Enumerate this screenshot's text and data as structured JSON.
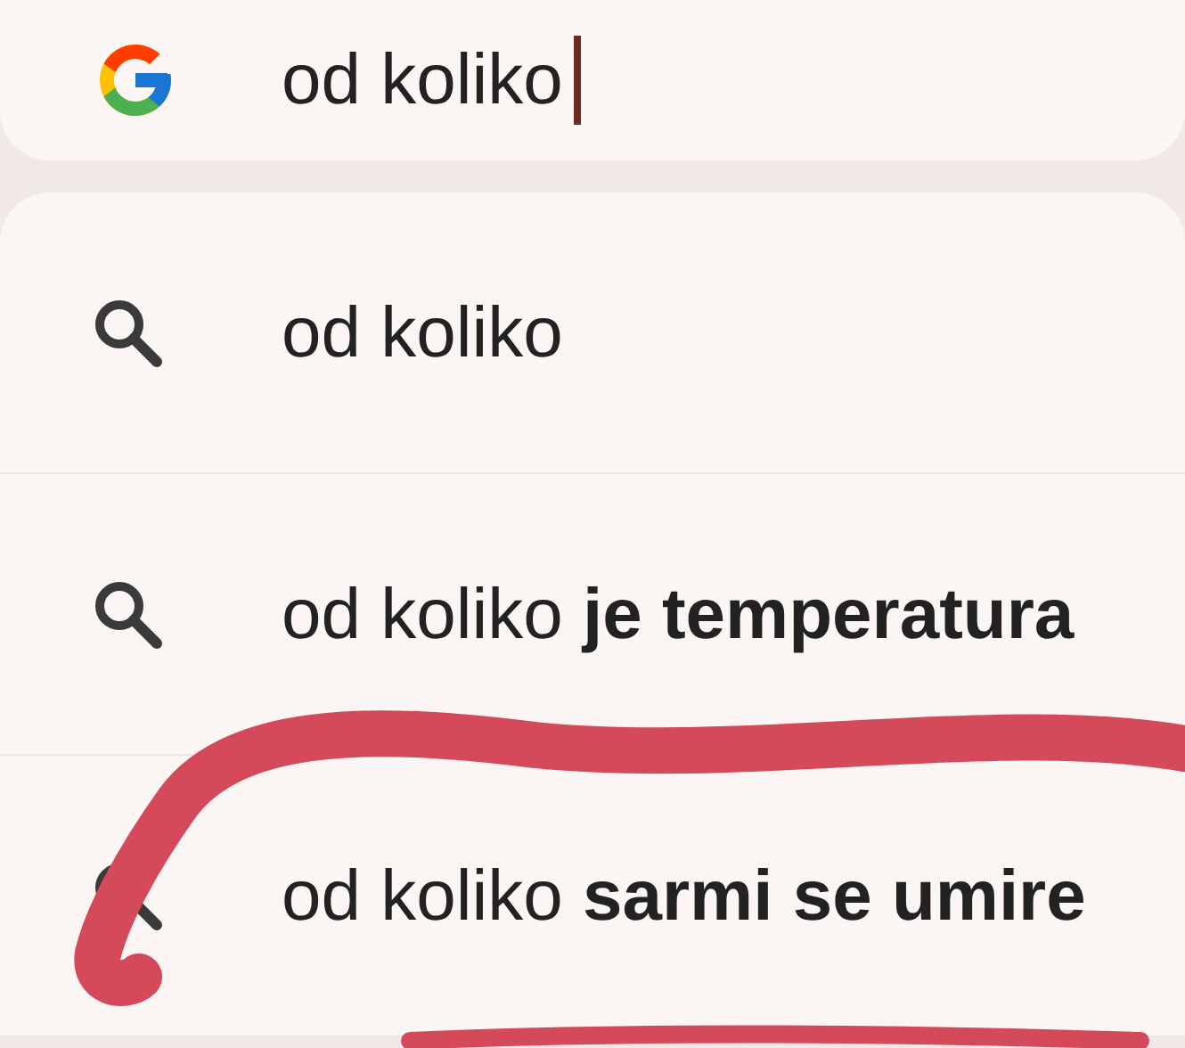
{
  "search": {
    "value": "od koliko"
  },
  "suggestions": [
    {
      "text": "od koliko"
    },
    {
      "text": "od koliko **je temperatura**"
    },
    {
      "text": "od koliko **sarmi se umire**"
    }
  ]
}
